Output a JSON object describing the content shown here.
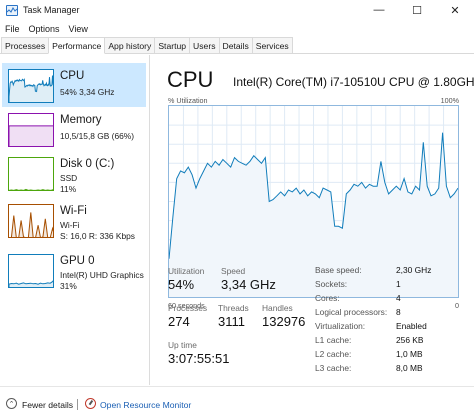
{
  "window": {
    "title": "Task Manager",
    "minimize": "—",
    "maximize": "☐",
    "close": "✕"
  },
  "menu": [
    "File",
    "Options",
    "View"
  ],
  "tabs": [
    "Processes",
    "Performance",
    "App history",
    "Startup",
    "Users",
    "Details",
    "Services"
  ],
  "active_tab": "Performance",
  "sidebar": [
    {
      "title": "CPU",
      "sub": [
        "54% 3,34 GHz"
      ],
      "color": "#117dbb"
    },
    {
      "title": "Memory",
      "sub": [
        "10,5/15,8 GB (66%)"
      ],
      "color": "#8b12ae"
    },
    {
      "title": "Disk 0 (C:)",
      "sub": [
        "SSD",
        "11%"
      ],
      "color": "#4da60c"
    },
    {
      "title": "Wi-Fi",
      "sub": [
        "Wi-Fi",
        "S: 16,0  R: 336 Kbps"
      ],
      "color": "#a74f01"
    },
    {
      "title": "GPU 0",
      "sub": [
        "Intel(R) UHD Graphics",
        "31%"
      ],
      "color": "#117dbb"
    }
  ],
  "main": {
    "title": "CPU",
    "model": "Intel(R) Core(TM) i7-10510U CPU @ 1.80GHz",
    "y_axis_label": "% Utilization",
    "y_max_label": "100%",
    "x_left_label": "60 seconds",
    "x_right_label": "0"
  },
  "stats": {
    "utilization_label": "Utilization",
    "utilization": "54%",
    "speed_label": "Speed",
    "speed": "3,34 GHz",
    "processes_label": "Processes",
    "processes": "274",
    "threads_label": "Threads",
    "threads": "3111",
    "handles_label": "Handles",
    "handles": "132976",
    "uptime_label": "Up time",
    "uptime": "3:07:55:51"
  },
  "specs": [
    {
      "label": "Base speed:",
      "value": "2,30 GHz"
    },
    {
      "label": "Sockets:",
      "value": "1"
    },
    {
      "label": "Cores:",
      "value": "4"
    },
    {
      "label": "Logical processors:",
      "value": "8"
    },
    {
      "label": "Virtualization:",
      "value": "Enabled"
    },
    {
      "label": "L1 cache:",
      "value": "256 KB"
    },
    {
      "label": "L2 cache:",
      "value": "1,0 MB"
    },
    {
      "label": "L3 cache:",
      "value": "8,0 MB"
    }
  ],
  "footer": {
    "fewer_details": "Fewer details",
    "open_resource_monitor": "Open Resource Monitor"
  },
  "cpu_history": [
    20,
    42,
    62,
    66,
    65,
    68,
    64,
    57,
    62,
    66,
    70,
    68,
    71,
    69,
    72,
    70,
    68,
    73,
    71,
    70,
    69,
    71,
    74,
    72,
    70,
    73,
    50,
    51,
    53,
    55,
    53,
    56,
    55,
    57,
    54,
    56,
    53,
    55,
    54,
    52,
    57,
    56,
    55,
    37,
    37,
    36,
    54,
    56,
    59,
    58,
    60,
    57,
    59,
    58,
    58,
    71,
    60,
    54,
    56,
    58,
    56,
    62,
    55,
    54,
    58,
    56,
    81,
    58,
    53,
    54,
    57,
    86,
    58,
    52,
    54,
    57
  ],
  "memory_history": [
    66,
    66,
    66,
    66,
    66,
    66,
    66,
    66,
    66,
    66,
    66,
    66,
    66,
    66,
    66,
    66,
    66,
    66,
    66,
    66
  ],
  "disk_history": [
    2,
    3,
    2,
    4,
    2,
    3,
    2,
    5,
    2,
    3,
    2,
    2,
    3,
    2,
    4,
    2,
    3,
    2,
    3,
    11
  ],
  "wifi_history": [
    0,
    1,
    70,
    2,
    1,
    55,
    3,
    1,
    2,
    80,
    1,
    2,
    40,
    1,
    3,
    60,
    2,
    1,
    30,
    5
  ],
  "gpu_history": [
    12,
    14,
    13,
    15,
    12,
    14,
    16,
    13,
    14,
    15,
    13,
    14,
    12,
    15,
    13,
    14,
    16,
    15,
    20,
    31
  ]
}
